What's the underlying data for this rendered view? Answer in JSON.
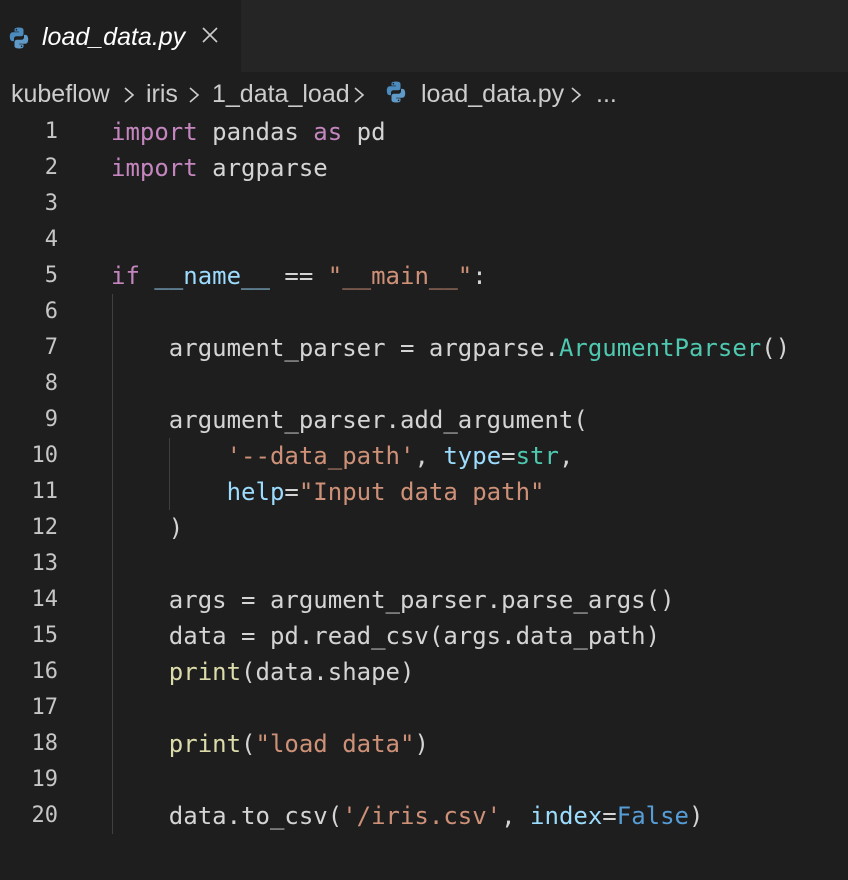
{
  "tab": {
    "title": "load_data.py",
    "icon": "python-icon"
  },
  "breadcrumb": {
    "items": [
      "kubeflow",
      "iris",
      "1_data_load",
      "load_data.py",
      "..."
    ]
  },
  "colors": {
    "background": "#1e1e1e",
    "keyword": "#c586c0",
    "variable": "#9cdcfe",
    "string": "#ce9178",
    "function": "#dcdcaa",
    "class": "#4ec9b0",
    "constant": "#569cd6"
  },
  "code": {
    "line_numbers": [
      "1",
      "2",
      "3",
      "4",
      "5",
      "6",
      "7",
      "8",
      "9",
      "10",
      "11",
      "12",
      "13",
      "14",
      "15",
      "16",
      "17",
      "18",
      "19",
      "20"
    ],
    "tokens": {
      "l1_import": "import",
      "l1_pandas": " pandas ",
      "l1_as": "as",
      "l1_pd": " pd",
      "l2_import": "import",
      "l2_argparse": " argparse",
      "l5_if": "if",
      "l5_sp": " ",
      "l5_name": "__name__",
      "l5_eq": " == ",
      "l5_main": "\"__main__\"",
      "l5_colon": ":",
      "l7_text": "    argument_parser = argparse.",
      "l7_cls": "ArgumentParser",
      "l7_paren": "()",
      "l9_text": "    argument_parser.add_argument(",
      "l10_indent": "        ",
      "l10_str": "'--data_path'",
      "l10_comma": ", ",
      "l10_type": "type",
      "l10_eq": "=",
      "l10_strcls": "str",
      "l10_end": ",",
      "l11_indent": "        ",
      "l11_help": "help",
      "l11_eq": "=",
      "l11_str": "\"Input data path\"",
      "l12_text": "    )",
      "l14_text": "    args = argument_parser.parse_args()",
      "l15_text": "    data = pd.read_csv(args.data_path)",
      "l16_indent": "    ",
      "l16_print": "print",
      "l16_rest": "(data.shape)",
      "l18_indent": "    ",
      "l18_print": "print",
      "l18_open": "(",
      "l18_str": "\"load data\"",
      "l18_close": ")",
      "l20_text": "    data.to_csv(",
      "l20_str": "'/iris.csv'",
      "l20_comma": ", ",
      "l20_index": "index",
      "l20_eq": "=",
      "l20_false": "False",
      "l20_close": ")"
    }
  }
}
